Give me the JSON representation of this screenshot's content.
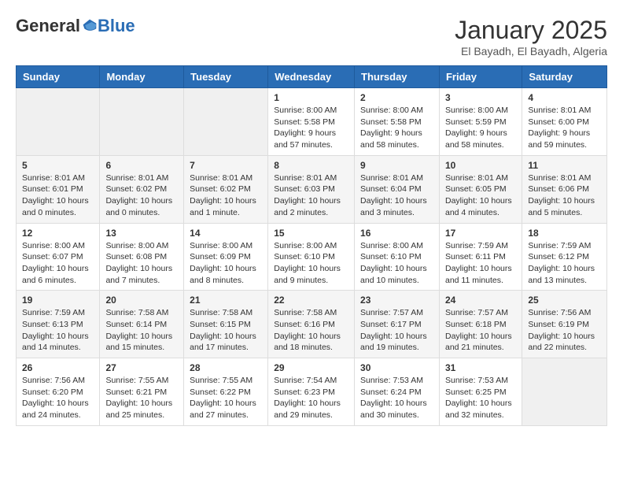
{
  "header": {
    "logo_general": "General",
    "logo_blue": "Blue",
    "main_title": "January 2025",
    "sub_title": "El Bayadh, El Bayadh, Algeria"
  },
  "weekdays": [
    "Sunday",
    "Monday",
    "Tuesday",
    "Wednesday",
    "Thursday",
    "Friday",
    "Saturday"
  ],
  "weeks": [
    [
      {
        "day": null,
        "info": null
      },
      {
        "day": null,
        "info": null
      },
      {
        "day": null,
        "info": null
      },
      {
        "day": "1",
        "info": "Sunrise: 8:00 AM\nSunset: 5:58 PM\nDaylight: 9 hours and 57 minutes."
      },
      {
        "day": "2",
        "info": "Sunrise: 8:00 AM\nSunset: 5:58 PM\nDaylight: 9 hours and 58 minutes."
      },
      {
        "day": "3",
        "info": "Sunrise: 8:00 AM\nSunset: 5:59 PM\nDaylight: 9 hours and 58 minutes."
      },
      {
        "day": "4",
        "info": "Sunrise: 8:01 AM\nSunset: 6:00 PM\nDaylight: 9 hours and 59 minutes."
      }
    ],
    [
      {
        "day": "5",
        "info": "Sunrise: 8:01 AM\nSunset: 6:01 PM\nDaylight: 10 hours and 0 minutes."
      },
      {
        "day": "6",
        "info": "Sunrise: 8:01 AM\nSunset: 6:02 PM\nDaylight: 10 hours and 0 minutes."
      },
      {
        "day": "7",
        "info": "Sunrise: 8:01 AM\nSunset: 6:02 PM\nDaylight: 10 hours and 1 minute."
      },
      {
        "day": "8",
        "info": "Sunrise: 8:01 AM\nSunset: 6:03 PM\nDaylight: 10 hours and 2 minutes."
      },
      {
        "day": "9",
        "info": "Sunrise: 8:01 AM\nSunset: 6:04 PM\nDaylight: 10 hours and 3 minutes."
      },
      {
        "day": "10",
        "info": "Sunrise: 8:01 AM\nSunset: 6:05 PM\nDaylight: 10 hours and 4 minutes."
      },
      {
        "day": "11",
        "info": "Sunrise: 8:01 AM\nSunset: 6:06 PM\nDaylight: 10 hours and 5 minutes."
      }
    ],
    [
      {
        "day": "12",
        "info": "Sunrise: 8:00 AM\nSunset: 6:07 PM\nDaylight: 10 hours and 6 minutes."
      },
      {
        "day": "13",
        "info": "Sunrise: 8:00 AM\nSunset: 6:08 PM\nDaylight: 10 hours and 7 minutes."
      },
      {
        "day": "14",
        "info": "Sunrise: 8:00 AM\nSunset: 6:09 PM\nDaylight: 10 hours and 8 minutes."
      },
      {
        "day": "15",
        "info": "Sunrise: 8:00 AM\nSunset: 6:10 PM\nDaylight: 10 hours and 9 minutes."
      },
      {
        "day": "16",
        "info": "Sunrise: 8:00 AM\nSunset: 6:10 PM\nDaylight: 10 hours and 10 minutes."
      },
      {
        "day": "17",
        "info": "Sunrise: 7:59 AM\nSunset: 6:11 PM\nDaylight: 10 hours and 11 minutes."
      },
      {
        "day": "18",
        "info": "Sunrise: 7:59 AM\nSunset: 6:12 PM\nDaylight: 10 hours and 13 minutes."
      }
    ],
    [
      {
        "day": "19",
        "info": "Sunrise: 7:59 AM\nSunset: 6:13 PM\nDaylight: 10 hours and 14 minutes."
      },
      {
        "day": "20",
        "info": "Sunrise: 7:58 AM\nSunset: 6:14 PM\nDaylight: 10 hours and 15 minutes."
      },
      {
        "day": "21",
        "info": "Sunrise: 7:58 AM\nSunset: 6:15 PM\nDaylight: 10 hours and 17 minutes."
      },
      {
        "day": "22",
        "info": "Sunrise: 7:58 AM\nSunset: 6:16 PM\nDaylight: 10 hours and 18 minutes."
      },
      {
        "day": "23",
        "info": "Sunrise: 7:57 AM\nSunset: 6:17 PM\nDaylight: 10 hours and 19 minutes."
      },
      {
        "day": "24",
        "info": "Sunrise: 7:57 AM\nSunset: 6:18 PM\nDaylight: 10 hours and 21 minutes."
      },
      {
        "day": "25",
        "info": "Sunrise: 7:56 AM\nSunset: 6:19 PM\nDaylight: 10 hours and 22 minutes."
      }
    ],
    [
      {
        "day": "26",
        "info": "Sunrise: 7:56 AM\nSunset: 6:20 PM\nDaylight: 10 hours and 24 minutes."
      },
      {
        "day": "27",
        "info": "Sunrise: 7:55 AM\nSunset: 6:21 PM\nDaylight: 10 hours and 25 minutes."
      },
      {
        "day": "28",
        "info": "Sunrise: 7:55 AM\nSunset: 6:22 PM\nDaylight: 10 hours and 27 minutes."
      },
      {
        "day": "29",
        "info": "Sunrise: 7:54 AM\nSunset: 6:23 PM\nDaylight: 10 hours and 29 minutes."
      },
      {
        "day": "30",
        "info": "Sunrise: 7:53 AM\nSunset: 6:24 PM\nDaylight: 10 hours and 30 minutes."
      },
      {
        "day": "31",
        "info": "Sunrise: 7:53 AM\nSunset: 6:25 PM\nDaylight: 10 hours and 32 minutes."
      },
      {
        "day": null,
        "info": null
      }
    ]
  ]
}
